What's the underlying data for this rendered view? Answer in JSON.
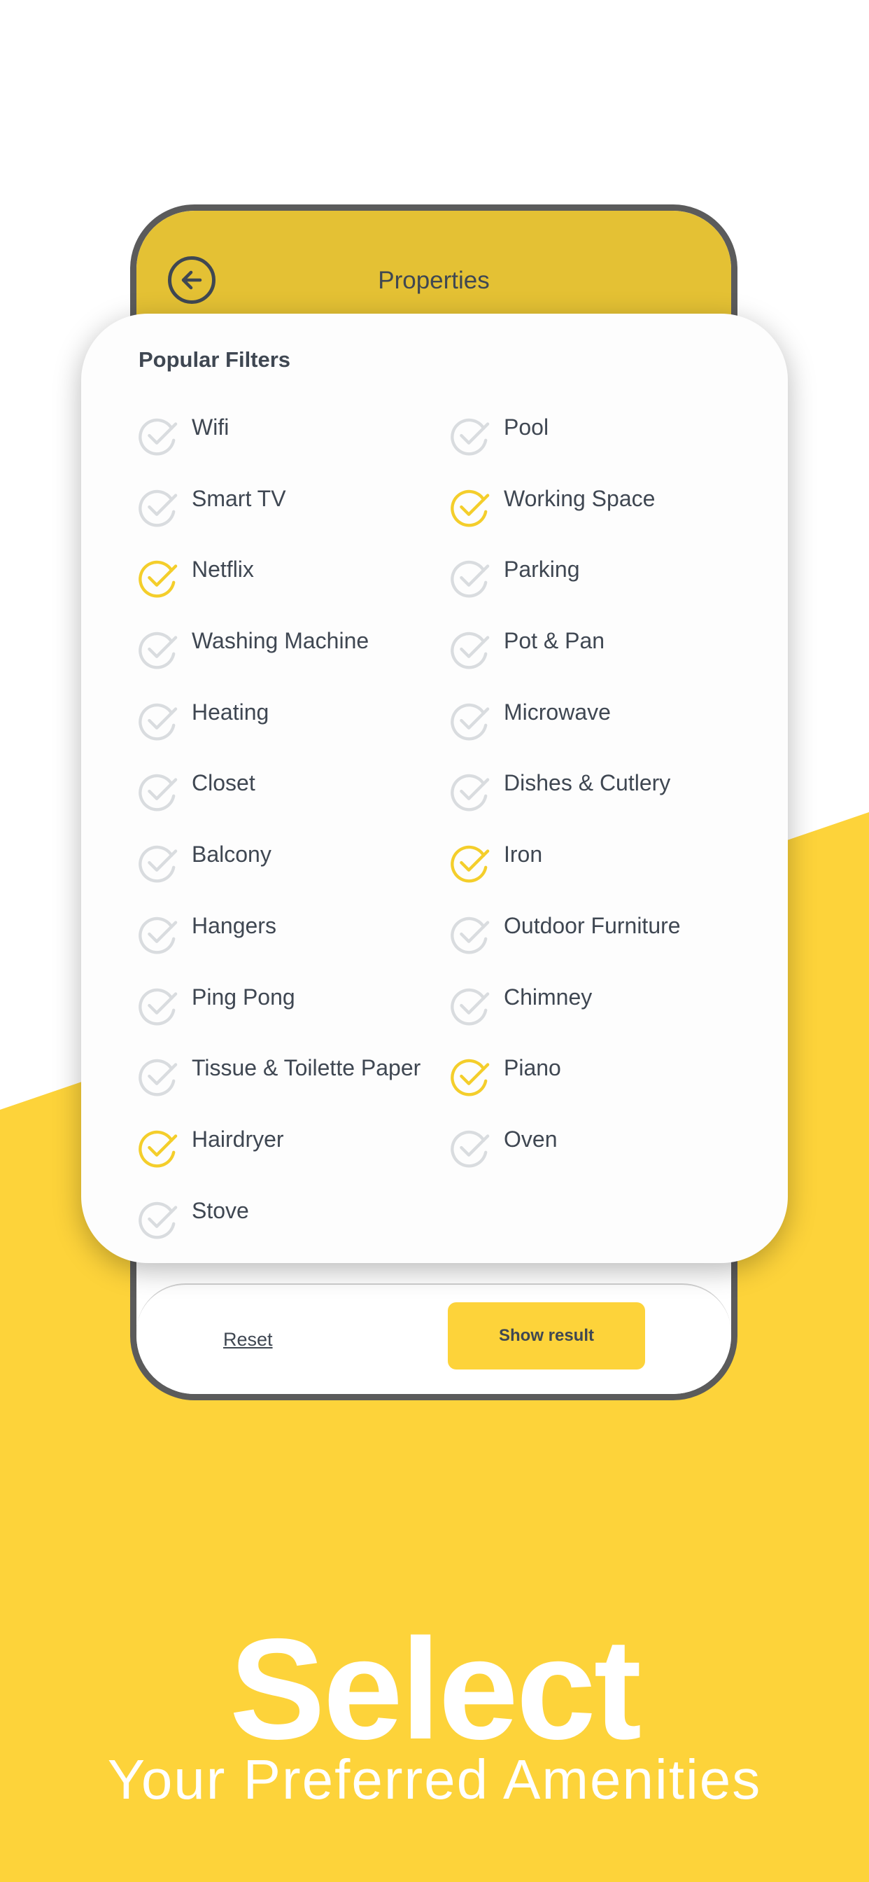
{
  "colors": {
    "accent": "#FDD33A",
    "header": "#E4C134",
    "text": "#3f4752",
    "check_off": "#d9dcdf",
    "check_on": "#F4CE2B"
  },
  "header": {
    "title": "Properties",
    "back_icon": "arrow-left-circle-icon"
  },
  "filters": {
    "title": "Popular Filters",
    "items": [
      {
        "label": "Wifi",
        "checked": false
      },
      {
        "label": "Pool",
        "checked": false
      },
      {
        "label": "Smart TV",
        "checked": false
      },
      {
        "label": "Working Space",
        "checked": true
      },
      {
        "label": "Netflix",
        "checked": true
      },
      {
        "label": "Parking",
        "checked": false
      },
      {
        "label": "Washing Machine",
        "checked": false
      },
      {
        "label": "Pot & Pan",
        "checked": false
      },
      {
        "label": "Heating",
        "checked": false
      },
      {
        "label": "Microwave",
        "checked": false
      },
      {
        "label": "Closet",
        "checked": false
      },
      {
        "label": "Dishes & Cutlery",
        "checked": false
      },
      {
        "label": "Balcony",
        "checked": false
      },
      {
        "label": "Iron",
        "checked": true
      },
      {
        "label": "Hangers",
        "checked": false
      },
      {
        "label": "Outdoor Furniture",
        "checked": false
      },
      {
        "label": "Ping Pong",
        "checked": false
      },
      {
        "label": "Chimney",
        "checked": false
      },
      {
        "label": "Tissue & Toilette Paper",
        "checked": false
      },
      {
        "label": "Piano",
        "checked": true
      },
      {
        "label": "Hairdryer",
        "checked": true
      },
      {
        "label": "Oven",
        "checked": false
      },
      {
        "label": "Stove",
        "checked": false
      }
    ]
  },
  "footer": {
    "reset_label": "Reset",
    "show_result_label": "Show result"
  },
  "promo": {
    "title": "Select",
    "subtitle": "Your Preferred Amenities"
  }
}
